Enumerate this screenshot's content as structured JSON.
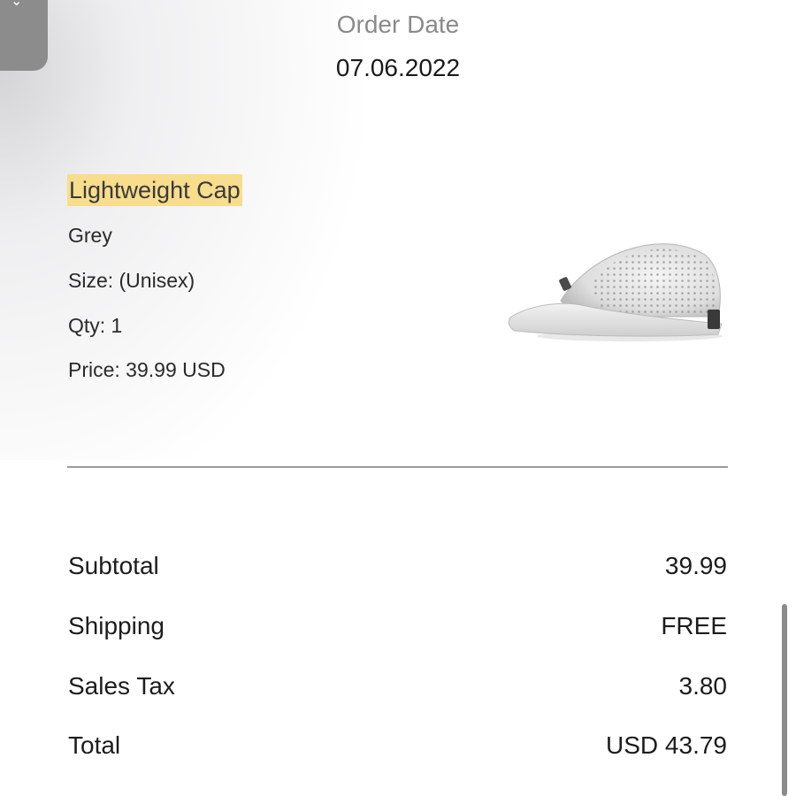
{
  "order": {
    "date_label": "Order Date",
    "date": "07.06.2022"
  },
  "product": {
    "name": "Lightweight Cap",
    "color": "Grey",
    "size": "Size: (Unisex)",
    "qty": "Qty: 1",
    "price": "Price: 39.99 USD",
    "image_icon": "white-cap-image",
    "highlight_color": "#f7dd8c"
  },
  "summary": {
    "subtotal_label": "Subtotal",
    "subtotal_value": "39.99",
    "shipping_label": "Shipping",
    "shipping_value": "FREE",
    "tax_label": "Sales Tax",
    "tax_value": "3.80",
    "total_label": "Total",
    "total_value": "USD 43.79"
  },
  "colors": {
    "label_grey": "#8a8a8a",
    "text_dark": "#1c1c1c"
  }
}
